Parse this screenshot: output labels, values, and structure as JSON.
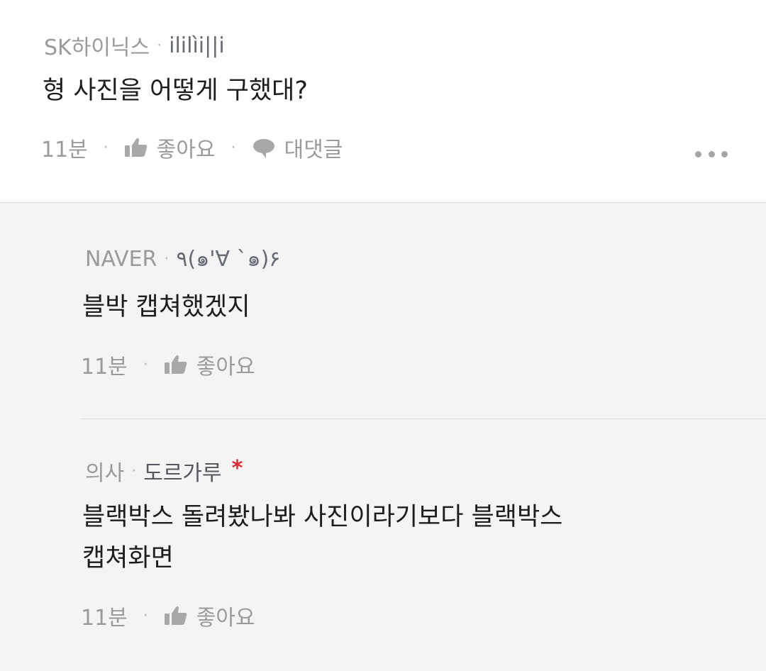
{
  "comments": [
    {
      "author": "SK하이닉스",
      "nickname": "ililìi||i",
      "text": "형 사진을 어떻게 구했대?",
      "time": "11분",
      "like_label": "좋아요",
      "reply_label": "대댓글"
    }
  ],
  "replies": [
    {
      "author": "NAVER",
      "nickname": "٩(๑'∀ `๑)۶",
      "text": "블박 캡쳐했겠지",
      "time": "11분",
      "like_label": "좋아요"
    },
    {
      "author": "의사",
      "nickname": "도르가루",
      "badge": "*",
      "text_line1": "블랙박스 돌려봤나봐  사진이라기보다 블랙박스",
      "text_line2": "캡쳐화면",
      "time": "11분",
      "like_label": "좋아요"
    }
  ],
  "separator": "·",
  "icons": {
    "like": "thumbs-up-icon",
    "reply": "speech-bubble-icon",
    "more": "more-dots-icon"
  },
  "colors": {
    "accent_star": "#e0282e",
    "meta": "#9b9b9b",
    "reply_bg": "#f4f4f4"
  }
}
